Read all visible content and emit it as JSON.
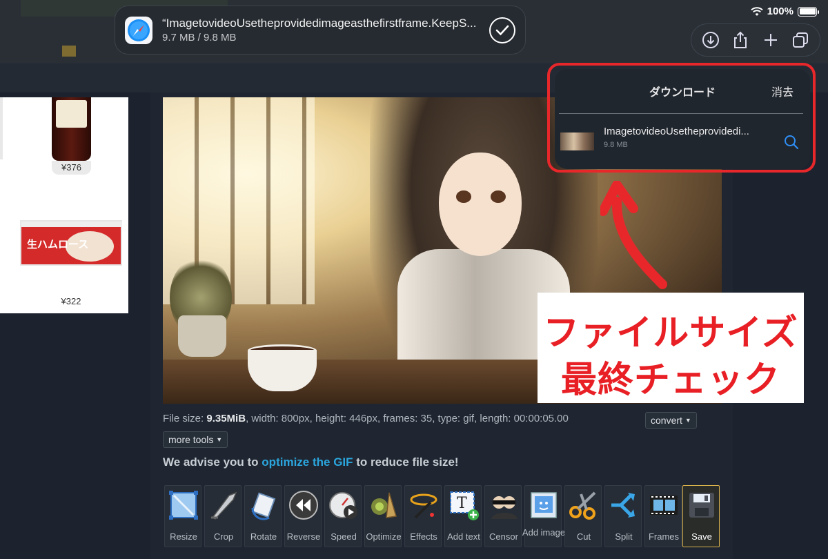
{
  "status": {
    "battery_text": "100%"
  },
  "toast": {
    "title": "“ImagetovideoUsetheprovidedimageasthefirstframe.KeepS...",
    "progress": "9.7 MB / 9.8 MB"
  },
  "downloads": {
    "title": "ダウンロード",
    "clear": "消去",
    "file_name": "ImagetovideoUsetheprovidedi...",
    "file_size": "9.8 MB"
  },
  "products": [
    {
      "price": "¥376"
    },
    {
      "price": "¥322",
      "label": "生ハムロース"
    }
  ],
  "annotation": {
    "line1": "ファイルサイズ",
    "line2": "最終チェック"
  },
  "file_info": {
    "prefix": "File size:",
    "size": "9.35MiB",
    "rest": ", width: 800px, height: 446px, frames: 35, type: gif, length: 00:00:05.00"
  },
  "buttons": {
    "convert": "convert",
    "more_tools": "more tools"
  },
  "advise": {
    "before": "We advise you to",
    "link": "optimize the GIF",
    "after": "to reduce file size!"
  },
  "tools": [
    {
      "label": "Resize",
      "icon": "resize-icon"
    },
    {
      "label": "Crop",
      "icon": "crop-icon"
    },
    {
      "label": "Rotate",
      "icon": "rotate-icon"
    },
    {
      "label": "Reverse",
      "icon": "reverse-icon"
    },
    {
      "label": "Speed",
      "icon": "speed-icon"
    },
    {
      "label": "Optimize",
      "icon": "optimize-icon"
    },
    {
      "label": "Effects",
      "icon": "effects-icon"
    },
    {
      "label": "Add text",
      "icon": "add-text-icon"
    },
    {
      "label": "Censor",
      "icon": "censor-icon"
    },
    {
      "label": "Add image",
      "icon": "add-image-icon"
    },
    {
      "label": "Cut",
      "icon": "cut-icon"
    },
    {
      "label": "Split",
      "icon": "split-icon"
    },
    {
      "label": "Frames",
      "icon": "frames-icon"
    },
    {
      "label": "Save",
      "icon": "save-icon"
    }
  ],
  "colors": {
    "annotation_red": "#e81f24",
    "link_blue": "#2ba6de",
    "save_border": "#d9b24c"
  }
}
